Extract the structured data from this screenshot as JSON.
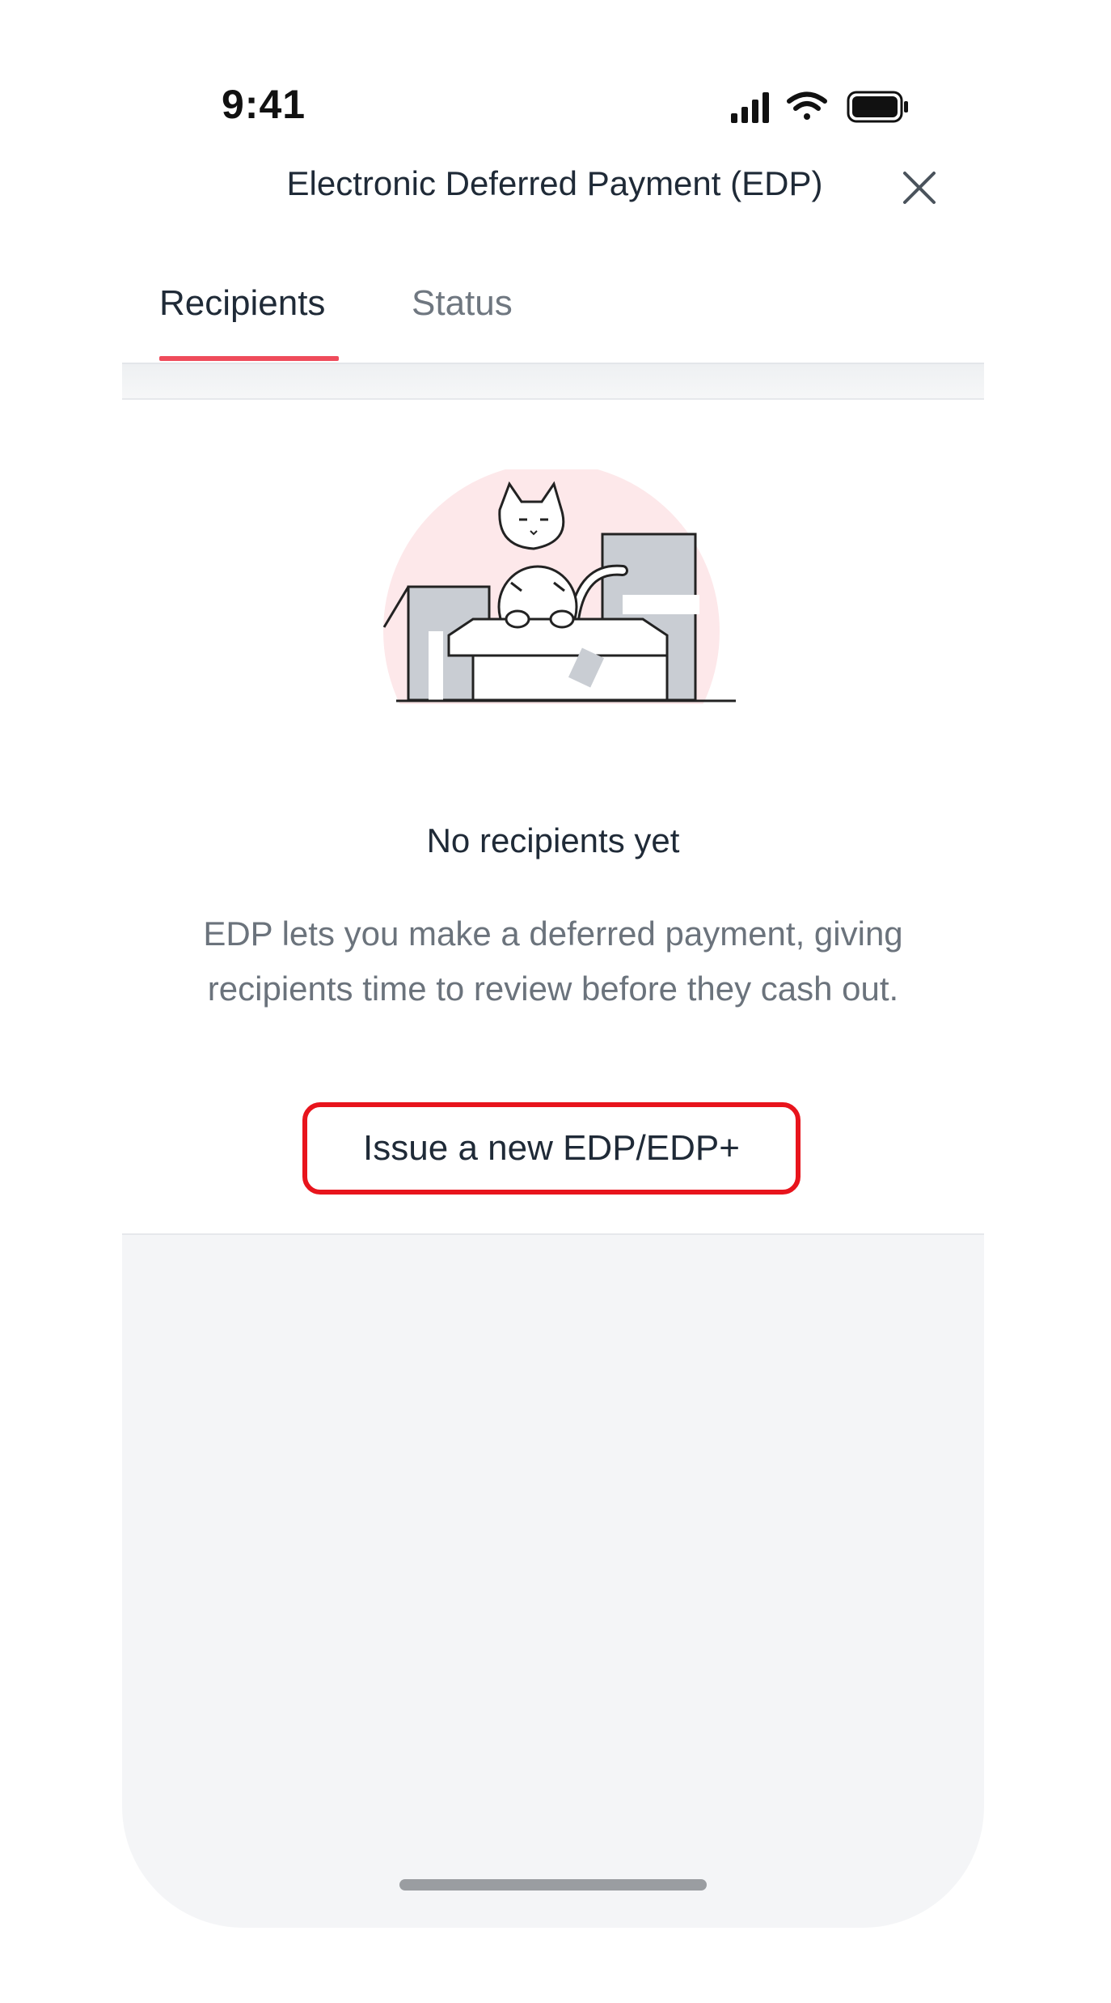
{
  "status_bar": {
    "time": "9:41"
  },
  "header": {
    "title": "Electronic Deferred Payment (EDP)",
    "close_icon": "close-icon"
  },
  "tabs": [
    {
      "label": "Recipients",
      "active": true
    },
    {
      "label": "Status",
      "active": false
    }
  ],
  "empty_state": {
    "illustration": "cat-in-box-illustration",
    "title": "No recipients yet",
    "description": "EDP lets you make a deferred payment, giving recipients time to review before they cash out.",
    "cta_label": "Issue a new EDP/EDP+"
  },
  "colors": {
    "accent": "#ef4b5b",
    "highlight_border": "#e8141c",
    "text_primary": "#1f2a37",
    "text_secondary": "#6b737c",
    "background_gray": "#f4f5f7"
  }
}
